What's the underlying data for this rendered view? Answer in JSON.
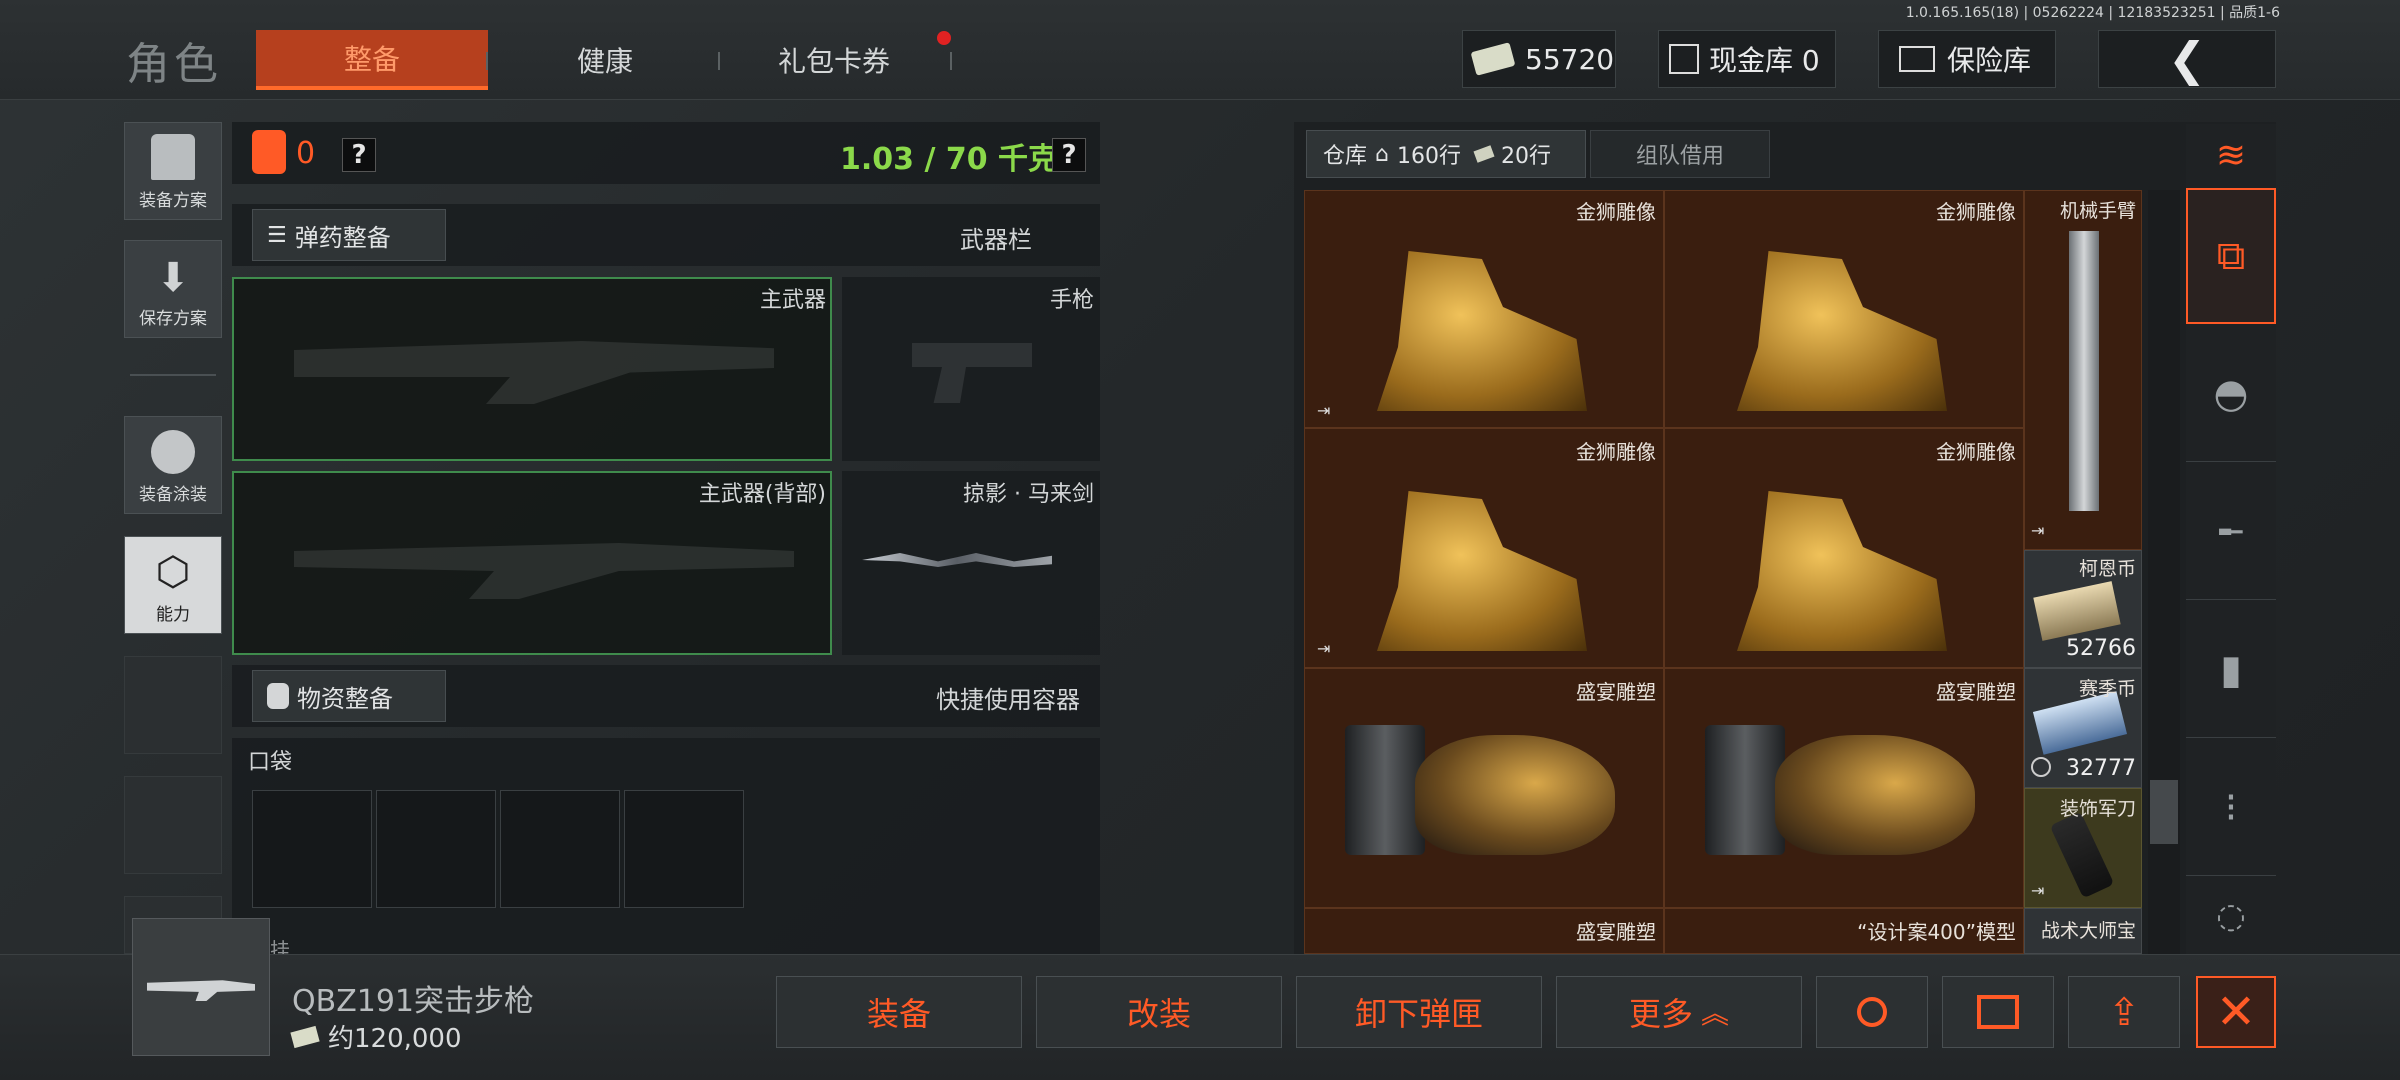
{
  "version": "1.0.165.165(18) | 05262224 | 12183523251 | 品质1-6",
  "brand": "角色",
  "tabs": [
    {
      "label": "整备",
      "active": true
    },
    {
      "label": "健康",
      "active": false
    },
    {
      "label": "礼包卡券",
      "active": false,
      "badge": true
    }
  ],
  "currency": {
    "amount": "55720",
    "cash_vault_label": "现金库 0",
    "safe_label": "保险库"
  },
  "side_menu": {
    "loadout": "装备方案",
    "save": "保存方案",
    "skin": "装备涂装",
    "ability": "能力"
  },
  "loadout": {
    "armor_count": "0",
    "weight": "1.03 / 70 千克",
    "ammo_btn": "弹药整备",
    "weapon_bar": "武器栏",
    "slots": {
      "primary": "主武器",
      "pistol": "手枪",
      "primary_back": "主武器(背部)",
      "melee": "掠影 · 马来剑"
    },
    "supply_btn": "物资整备",
    "quick_container": "快捷使用容器",
    "pocket": "口袋",
    "hang": "挂"
  },
  "warehouse": {
    "tab_label": "仓库",
    "rows_home": "160行",
    "rows_other": "20行",
    "team_borrow": "组队借用",
    "items": [
      {
        "name": "金狮雕像"
      },
      {
        "name": "金狮雕像"
      },
      {
        "name": "机械手臂"
      },
      {
        "name": "金狮雕像"
      },
      {
        "name": "金狮雕像"
      },
      {
        "name": "柯恩币",
        "count": "52766"
      },
      {
        "name": "盛宴雕塑"
      },
      {
        "name": "盛宴雕塑"
      },
      {
        "name": "赛季币",
        "count": "32777"
      },
      {
        "name": "装饰军刀"
      },
      {
        "name": "盛宴雕塑"
      },
      {
        "name": "“设计案400”模型"
      },
      {
        "name": "战术大师宝"
      }
    ]
  },
  "selected_item": {
    "name": "QBZ191突击步枪",
    "price": "约120,000"
  },
  "actions": {
    "equip": "装备",
    "modify": "改装",
    "unload": "卸下弹匣",
    "more": "更多"
  },
  "colors": {
    "accent": "#ff5a26",
    "weight_green": "#8bd94a",
    "warehouse_bg": "#3a1e0f"
  }
}
